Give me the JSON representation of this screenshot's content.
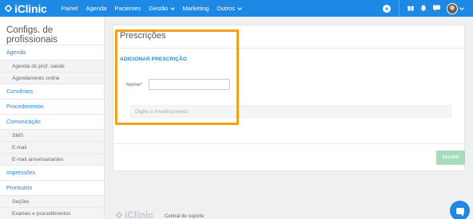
{
  "brand": {
    "name": "iClinic"
  },
  "navbar": {
    "items": [
      {
        "label": "Painel"
      },
      {
        "label": "Agenda"
      },
      {
        "label": "Pacientes"
      },
      {
        "label": "Gestão"
      },
      {
        "label": "Marketing"
      },
      {
        "label": "Outros"
      }
    ],
    "icons": [
      "plus-circle-icon",
      "gift-icon",
      "bell-icon",
      "chat-icon",
      "avatar"
    ]
  },
  "sidebar": {
    "title": "Configs. de profissionais",
    "sections": [
      {
        "label": "Agenda",
        "items": [
          "Agenda do prof. saúde",
          "Agendamento online"
        ]
      },
      {
        "label": "Convênios",
        "items": []
      },
      {
        "label": "Procedimentos",
        "items": []
      },
      {
        "label": "Comunicação",
        "items": [
          "SMS",
          "E-mail",
          "E-mail aniversariantes"
        ]
      },
      {
        "label": "Impressões",
        "items": []
      },
      {
        "label": "Prontuário",
        "items": [
          "Seções",
          "Exames e procedimentos"
        ]
      }
    ]
  },
  "main": {
    "title": "Prescrições",
    "add_link": "ADICIONAR PRESCRIÇÃO",
    "name_label": "Nome*",
    "name_value": "",
    "med_placeholder": "Digite o #medicamento",
    "save_label": "SALVAR"
  },
  "footer": {
    "logo": "iClinic",
    "support": "Central de suporte"
  },
  "colors": {
    "brand": "#1e88e5",
    "highlight": "#f0a21a",
    "save": "#a6dcbc"
  }
}
